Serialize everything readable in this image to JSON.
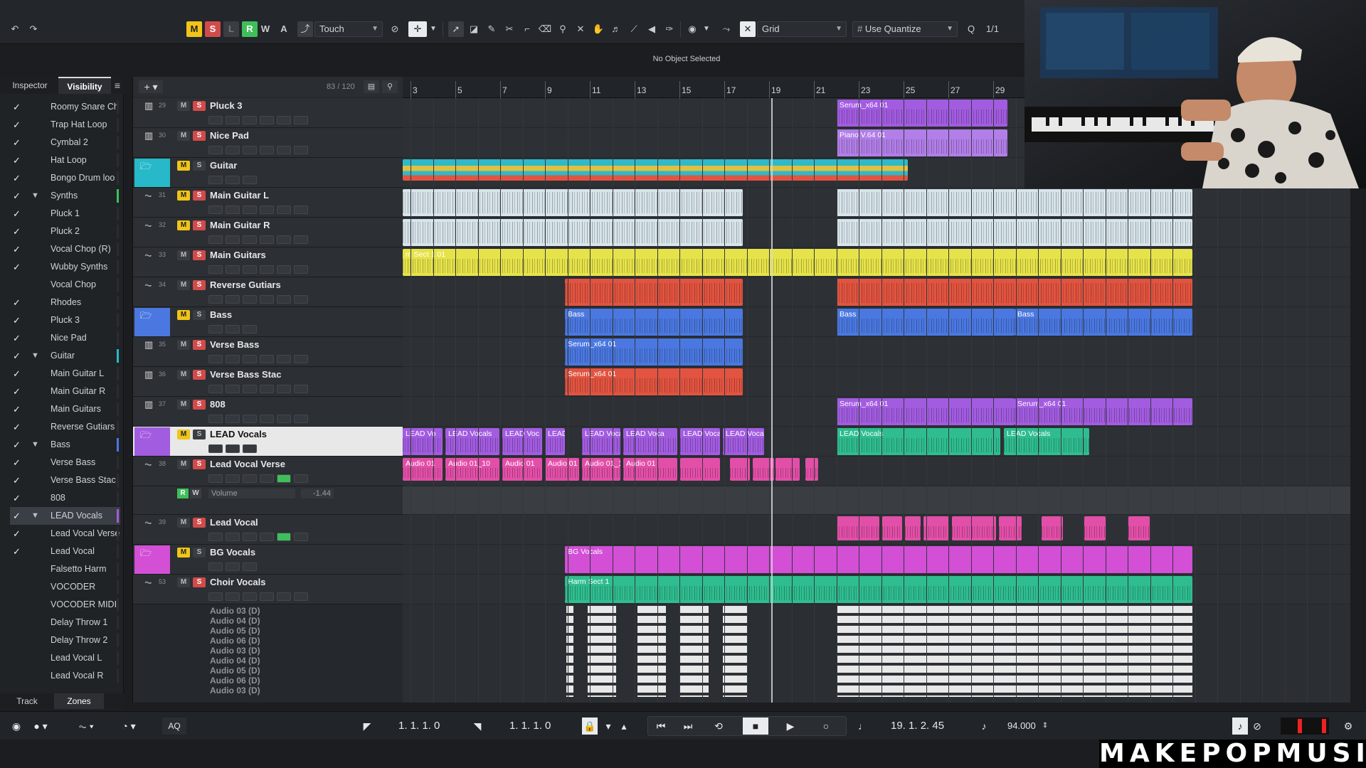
{
  "toolbar": {
    "undo_icon": "undo-icon",
    "redo_icon": "redo-icon",
    "m_label": "M",
    "s_label": "S",
    "l_label": "L",
    "r_label": "R",
    "w_label": "W",
    "a_label": "A",
    "automation_mode": "Touch",
    "snap_type": "Grid",
    "quantize": "Use Quantize",
    "quantize_value": "1/1"
  },
  "status": {
    "selection": "No Object Selected"
  },
  "left_zone": {
    "tabs": [
      "Inspector",
      "Visibility"
    ],
    "bottom_tabs": [
      "Track",
      "Zones"
    ],
    "visibility_items": [
      {
        "label": "Roomy Snare Ch",
        "checked": true,
        "folder": false,
        "color": "#2a2c30"
      },
      {
        "label": "Trap Hat Loop",
        "checked": true,
        "folder": false,
        "color": "#2a2c30"
      },
      {
        "label": "Cymbal 2",
        "checked": true,
        "folder": false,
        "color": "#2a2c30"
      },
      {
        "label": "Hat Loop",
        "checked": true,
        "folder": false,
        "color": "#2a2c30"
      },
      {
        "label": "Bongo Drum loo",
        "checked": true,
        "folder": false,
        "color": "#2a2c30"
      },
      {
        "label": "Synths",
        "checked": true,
        "folder": true,
        "color": "#3fbf5a"
      },
      {
        "label": "Pluck 1",
        "checked": true,
        "folder": false,
        "color": "#2a2c30"
      },
      {
        "label": "Pluck 2",
        "checked": true,
        "folder": false,
        "color": "#2a2c30"
      },
      {
        "label": "Vocal  Chop (R)",
        "checked": true,
        "folder": false,
        "color": "#2a2c30"
      },
      {
        "label": "Wubby Synths",
        "checked": true,
        "folder": false,
        "color": "#2a2c30"
      },
      {
        "label": "Vocal  Chop",
        "checked": false,
        "folder": false,
        "color": "#2a2c30"
      },
      {
        "label": "Rhodes",
        "checked": true,
        "folder": false,
        "color": "#2a2c30"
      },
      {
        "label": "Pluck 3",
        "checked": true,
        "folder": false,
        "color": "#2a2c30"
      },
      {
        "label": "Nice Pad",
        "checked": true,
        "folder": false,
        "color": "#2a2c30"
      },
      {
        "label": "Guitar",
        "checked": true,
        "folder": true,
        "color": "#27b9c9"
      },
      {
        "label": "Main Guitar L",
        "checked": true,
        "folder": false,
        "color": "#2a2c30"
      },
      {
        "label": "Main Guitar R",
        "checked": true,
        "folder": false,
        "color": "#2a2c30"
      },
      {
        "label": "Main Guitars",
        "checked": true,
        "folder": false,
        "color": "#2a2c30"
      },
      {
        "label": "Reverse Gutiars",
        "checked": true,
        "folder": false,
        "color": "#2a2c30"
      },
      {
        "label": "Bass",
        "checked": true,
        "folder": true,
        "color": "#4a78e0"
      },
      {
        "label": "Verse Bass",
        "checked": true,
        "folder": false,
        "color": "#2a2c30"
      },
      {
        "label": "Verse Bass Stac",
        "checked": true,
        "folder": false,
        "color": "#2a2c30"
      },
      {
        "label": "808",
        "checked": true,
        "folder": false,
        "color": "#2a2c30"
      },
      {
        "label": "LEAD Vocals",
        "checked": true,
        "folder": true,
        "color": "#a25ce0",
        "selected": true
      },
      {
        "label": "Lead Vocal Verse",
        "checked": true,
        "folder": false,
        "color": "#2a2c30"
      },
      {
        "label": "Lead Vocal",
        "checked": true,
        "folder": false,
        "color": "#2a2c30"
      },
      {
        "label": "Falsetto Harm",
        "checked": false,
        "folder": false,
        "color": "#2a2c30"
      },
      {
        "label": "VOCODER",
        "checked": false,
        "folder": false,
        "color": "#2a2c30"
      },
      {
        "label": "VOCODER MIDI",
        "checked": false,
        "folder": false,
        "color": "#2a2c30"
      },
      {
        "label": "Delay Throw 1",
        "checked": false,
        "folder": false,
        "color": "#2a2c30"
      },
      {
        "label": "Delay Throw 2",
        "checked": false,
        "folder": false,
        "color": "#2a2c30"
      },
      {
        "label": "Lead Vocal L",
        "checked": false,
        "folder": false,
        "color": "#2a2c30"
      },
      {
        "label": "Lead Vocal R",
        "checked": false,
        "folder": false,
        "color": "#2a2c30"
      }
    ]
  },
  "tracklist": {
    "counter": "83 / 120",
    "tracks": [
      {
        "num": "29",
        "name": "Pluck 3",
        "type": "instrument",
        "m_active": false
      },
      {
        "num": "30",
        "name": "Nice Pad",
        "type": "instrument",
        "m_active": false
      },
      {
        "num": "",
        "name": "Guitar",
        "type": "folder",
        "color": "#27b9c9",
        "m_active": true
      },
      {
        "num": "31",
        "name": "Main Guitar L",
        "type": "audio",
        "m_active": true
      },
      {
        "num": "32",
        "name": "Main Guitar R",
        "type": "audio",
        "m_active": true
      },
      {
        "num": "33",
        "name": "Main Guitars",
        "type": "audio",
        "m_active": false
      },
      {
        "num": "34",
        "name": "Reverse Gutiars",
        "type": "audio",
        "m_active": false
      },
      {
        "num": "",
        "name": "Bass",
        "type": "folder",
        "color": "#4a78e0",
        "m_active": true
      },
      {
        "num": "35",
        "name": "Verse Bass",
        "type": "instrument",
        "m_active": false
      },
      {
        "num": "36",
        "name": "Verse Bass Stac",
        "type": "instrument",
        "m_active": false
      },
      {
        "num": "37",
        "name": "808",
        "type": "instrument",
        "m_active": false
      },
      {
        "num": "",
        "name": "LEAD Vocals",
        "type": "folder",
        "color": "#a25ce0",
        "m_active": true
      },
      {
        "num": "38",
        "name": "Lead Vocal Verse",
        "type": "audio",
        "m_active": false
      },
      {
        "num": "",
        "name": "Volume",
        "type": "automation",
        "value": "-1.44"
      },
      {
        "num": "39",
        "name": "Lead Vocal",
        "type": "audio",
        "m_active": false
      },
      {
        "num": "",
        "name": "BG Vocals",
        "type": "folder",
        "color": "#d24fd6",
        "m_active": true
      },
      {
        "num": "53",
        "name": "Choir Vocals",
        "type": "audio",
        "m_active": false
      }
    ],
    "mini_tracks": [
      "Audio 03 (D)",
      "Audio 04 (D)",
      "Audio 05 (D)",
      "Audio 06 (D)",
      "Audio 03 (D)",
      "Audio 04 (D)",
      "Audio 05 (D)",
      "Audio 06 (D)",
      "Audio 03 (D)"
    ]
  },
  "ruler": {
    "bars": [
      "3",
      "5",
      "7",
      "9",
      "11",
      "13",
      "15",
      "17",
      "19",
      "21",
      "23",
      "25",
      "27",
      "29"
    ]
  },
  "parts": {
    "pluck3": [
      "Serum_x64 01"
    ],
    "nicepad": [
      "Piano V.64 01"
    ],
    "main_guitars": [
      "m Sect 1 01"
    ],
    "bass_folder": [
      "Bass",
      "Bass",
      "Bass"
    ],
    "verse_bass": [
      "Serum_x64 01"
    ],
    "verse_bass_stac": [
      "Serum_x64 01"
    ],
    "eight08": [
      "Serum_x64 01",
      "Serum_x64 01"
    ],
    "lead_folder": [
      "LEAD Vo",
      "LEAD Vocals",
      "LEAD Voc",
      "LEAD Vo",
      "LEAD Vocals",
      "LEAD Voca",
      "LEAD Vocal",
      "LEAD Vocals",
      "LEAD Vocals",
      "LEAD Vocals"
    ],
    "lead_verse": [
      "Audio 01",
      "Audio 01_10",
      "Audio 01",
      "Audio 01",
      "Audio 01_10",
      "Audio 01"
    ],
    "bg_folder": [
      "BG Vocals"
    ],
    "choir": [
      "Harm Sect 1"
    ]
  },
  "transport": {
    "left_locator": "1. 1. 1.   0",
    "right_locator": "1. 1. 1.   0",
    "position": "19. 1. 2. 45",
    "tempo": "94.000",
    "aq_label": "AQ"
  },
  "watermark": "MAKEPOPMUSIC",
  "colors": {
    "accent": "#f0c419",
    "solo": "#d24b4b",
    "record": "#3fbf5a"
  }
}
